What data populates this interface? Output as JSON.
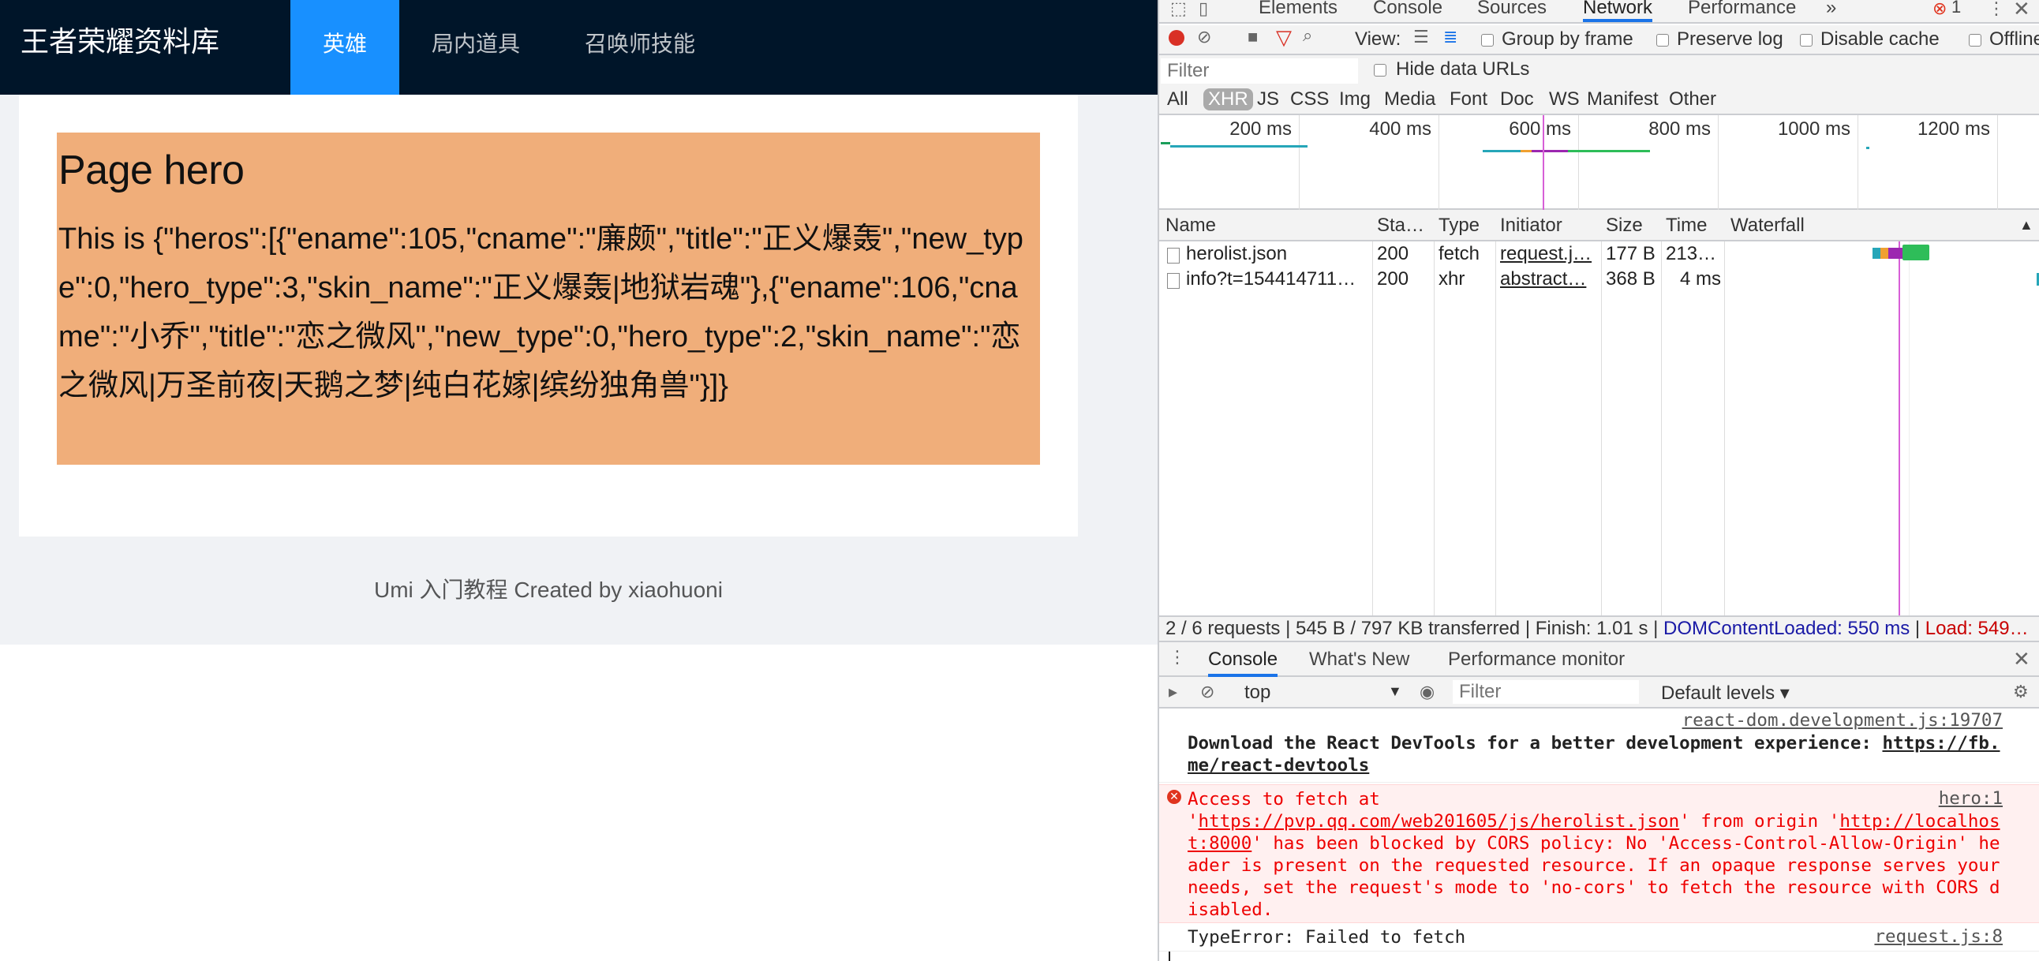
{
  "app": {
    "brand": "王者荣耀资料库",
    "nav": [
      {
        "label": "英雄",
        "active": true
      },
      {
        "label": "局内道具",
        "active": false
      },
      {
        "label": "召唤师技能",
        "active": false
      }
    ],
    "hero_title": "Page hero",
    "hero_text": "This is {\"heros\":[{\"ename\":105,\"cname\":\"廉颇\",\"title\":\"正义爆轰\",\"new_type\":0,\"hero_type\":3,\"skin_name\":\"正义爆轰|地狱岩魂\"},{\"ename\":106,\"cname\":\"小乔\",\"title\":\"恋之微风\",\"new_type\":0,\"hero_type\":2,\"skin_name\":\"恋之微风|万圣前夜|天鹅之梦|纯白花嫁|缤纷独角兽\"}]}",
    "footer": "Umi 入门教程 Created by xiaohuoni",
    "colors": {
      "header": "#001529",
      "nav_active": "#1890ff",
      "hero_box": "#f0ae7a"
    }
  },
  "devtools": {
    "tabs": [
      "Elements",
      "Console",
      "Sources",
      "Network",
      "Performance"
    ],
    "active_tab": "Network",
    "more": "»",
    "error_count": "1",
    "toolbar": {
      "view_label": "View:",
      "group_by_frame": "Group by frame",
      "preserve_log": "Preserve log",
      "disable_cache": "Disable cache",
      "offline": "Offline"
    },
    "filter": {
      "placeholder": "Filter",
      "hide_data_urls": "Hide data URLs"
    },
    "types": [
      "All",
      "XHR",
      "JS",
      "CSS",
      "Img",
      "Media",
      "Font",
      "Doc",
      "WS",
      "Manifest",
      "Other"
    ],
    "active_type": "XHR",
    "timeline_labels": [
      "200 ms",
      "400 ms",
      "600 ms",
      "800 ms",
      "1000 ms",
      "1200 ms"
    ],
    "columns": [
      "Name",
      "Sta…",
      "Type",
      "Initiator",
      "Size",
      "Time",
      "Waterfall"
    ],
    "rows": [
      {
        "name": "herolist.json",
        "status": "200",
        "type": "fetch",
        "initiator": "request.j…",
        "size": "177 B",
        "time": "213…"
      },
      {
        "name": "info?t=154414711…",
        "status": "200",
        "type": "xhr",
        "initiator": "abstract…",
        "size": "368 B",
        "time": "4 ms"
      }
    ],
    "status_bar": {
      "summary": "2 / 6 requests | 545 B / 797 KB transferred | Finish: 1.01 s | ",
      "dom_loaded": "DOMContentLoaded: 550 ms",
      "sep": " | ",
      "load": "Load: 549…"
    },
    "drawer_tabs": [
      "Console",
      "What's New",
      "Performance monitor"
    ],
    "console_toolbar": {
      "context": "top",
      "filter_placeholder": "Filter",
      "levels": "Default levels ▾"
    },
    "console": {
      "msg1_src": "react-dom.development.js:19707",
      "msg1_text": "Download the React DevTools for a better development experience: ",
      "msg1_link": "https://fb.me/react-devtools",
      "err_src": "hero:1",
      "err_a": "Access to fetch at\n'",
      "err_url": "https://pvp.qq.com/web201605/js/herolist.json",
      "err_b": "' from origin '",
      "err_origin": "http://localhost:8000",
      "err_c": "' has been blocked by CORS policy: No 'Access-Control-Allow-Origin' header is present on the requested resource. If an opaque response serves your needs, set the request's mode to 'no-cors' to fetch the resource with CORS disabled.",
      "msg3_text": "TypeError: Failed to fetch",
      "msg3_src": "request.js:8"
    }
  }
}
